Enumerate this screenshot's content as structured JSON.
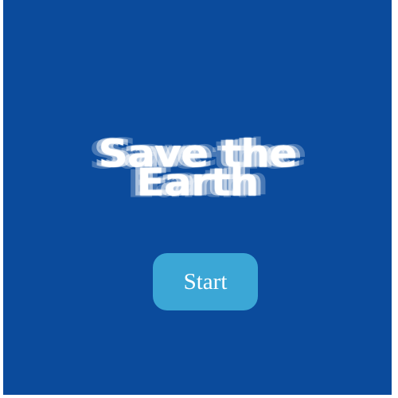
{
  "game": {
    "title_line1": "Save the",
    "title_line2": "Earth",
    "start_label": "Start"
  },
  "colors": {
    "background": "#0b4b9c",
    "button": "#3ba7d6",
    "text": "#ffffff"
  }
}
